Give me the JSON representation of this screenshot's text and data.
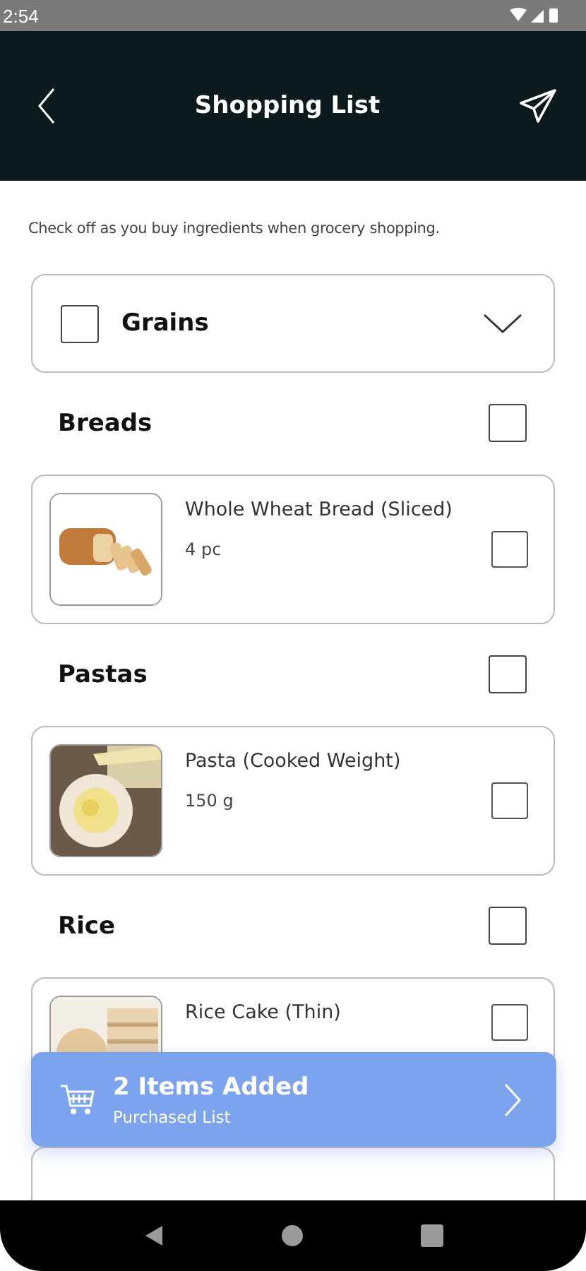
{
  "status_bar": {
    "time": "2:54"
  },
  "header": {
    "title": "Shopping List"
  },
  "intro": "Check off as you buy ingredients when grocery shopping.",
  "group": {
    "name": "Grains",
    "checked": false
  },
  "sections": [
    {
      "name": "Breads",
      "checked": false,
      "items": [
        {
          "name": "Whole Wheat Bread (Sliced)",
          "qty": "4 pc",
          "checked": false,
          "kind": "bread"
        }
      ]
    },
    {
      "name": "Pastas",
      "checked": false,
      "items": [
        {
          "name": "Pasta (Cooked Weight)",
          "qty": "150 g",
          "checked": false,
          "kind": "pasta"
        }
      ]
    },
    {
      "name": "Rice",
      "checked": false,
      "items": [
        {
          "name": "Rice Cake (Thin)",
          "checked": false,
          "kind": "rice"
        }
      ]
    }
  ],
  "banner": {
    "title": "2 Items Added",
    "subtitle": "Purchased List"
  }
}
